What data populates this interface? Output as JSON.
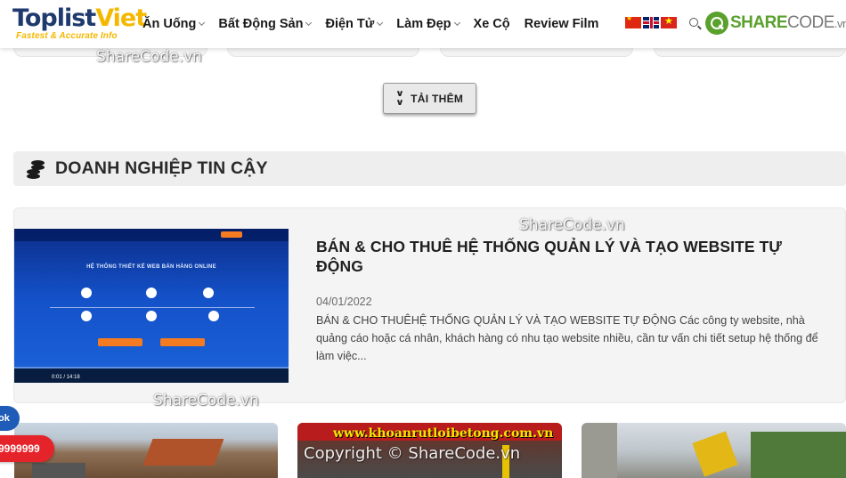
{
  "header": {
    "logo_main_part1": "Toplist",
    "logo_main_part2": "Viet",
    "logo_tagline": "Fastest & Accurate Info",
    "nav": [
      {
        "label": "Ăn Uống"
      },
      {
        "label": "Bất Động Sản"
      },
      {
        "label": "Điện Tử"
      },
      {
        "label": "Làm Đẹp"
      },
      {
        "label": "Xe Cộ"
      },
      {
        "label": "Review Film"
      }
    ],
    "languages": [
      "chinese-flag-icon",
      "uk-flag-icon",
      "vietnam-flag-icon"
    ],
    "search_icon": "search-icon",
    "partner_logo": {
      "share": "SHARE",
      "code": "CODE",
      "tld": ".vn"
    }
  },
  "watermarks": {
    "top": "ShareCode.vn",
    "mid": "ShareCode.vn",
    "left": "ShareCode.vn",
    "copyright": "Copyright © ShareCode.vn"
  },
  "load_more": {
    "label": "TẢI THÊM",
    "icon": "double-chevron-down-icon"
  },
  "section": {
    "title": "DOANH NGHIỆP TIN CẬY",
    "icon": "coins-icon"
  },
  "featured_post": {
    "title": "BÁN & CHO THUÊ HỆ THỐNG QUẢN LÝ VÀ TẠO WEBSITE TỰ ĐỘNG",
    "date": "04/01/2022",
    "excerpt": "BÁN & CHO THUÊHỆ THỐNG QUẢN LÝ VÀ TẠO WEBSITE TỰ ĐỘNG Các công ty website, nhà quảng cáo hoặc cá nhân, khách hàng có nhu tạo website nhiều, cần tư vấn chi tiết setup hệ thống để làm việc...",
    "thumbnail": {
      "heading": "HỆ THỐNG THIẾT KẾ WEB BÁN HÀNG ONLINE",
      "video_time": "0:01 / 14:18"
    }
  },
  "bottom_cards": [
    {
      "banner": ""
    },
    {
      "banner": "www.khoanrutloibetong.com.vn"
    },
    {
      "banner": ""
    }
  ],
  "float_buttons": {
    "blue": "ok",
    "red": "9999999"
  },
  "colors": {
    "brand_dark": "#1f3a6e",
    "brand_yellow": "#f5b800",
    "sharecode_green": "#5aa02c",
    "phone_red": "#e5232a",
    "float_blue": "#1e5cb8"
  }
}
